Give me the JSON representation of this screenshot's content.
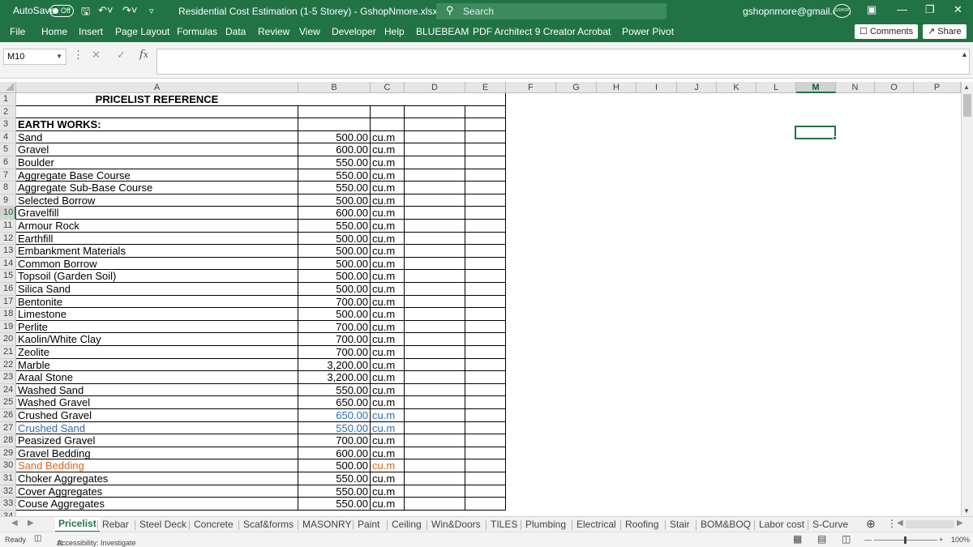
{
  "titlebar": {
    "autosave_label": "AutoSave",
    "autosave_state": "Off",
    "document_title": "Residential Cost Estimation (1-5 Storey) - GshopNmore.xlsx • Saved ∨",
    "search_placeholder": "Search",
    "account_email": "gshopnmore@gmail.com",
    "avatar_text": "GSHOP"
  },
  "ribbon": {
    "tabs": [
      "File",
      "Home",
      "Insert",
      "Page Layout",
      "Formulas",
      "Data",
      "Review",
      "View",
      "Developer",
      "Help",
      "BLUEBEAM",
      "PDF Architect 9 Creator",
      "Acrobat",
      "Power Pivot"
    ],
    "comments_label": "Comments",
    "share_label": "Share"
  },
  "formula_bar": {
    "name_box": "M10",
    "formula_value": ""
  },
  "columns": [
    "A",
    "B",
    "C",
    "D",
    "E",
    "F",
    "G",
    "H",
    "I",
    "J",
    "K",
    "L",
    "M",
    "N",
    "O",
    "P"
  ],
  "selected_column": "M",
  "selected_row": "10",
  "sheet": {
    "title": "PRICELIST REFERENCE",
    "section_header": "EARTH WORKS:",
    "rows": [
      {
        "n": "4",
        "item": "Sand",
        "price": "500.00",
        "unit": "cu.m"
      },
      {
        "n": "5",
        "item": "Gravel",
        "price": "600.00",
        "unit": "cu.m"
      },
      {
        "n": "6",
        "item": "Boulder",
        "price": "550.00",
        "unit": "cu.m"
      },
      {
        "n": "7",
        "item": "Aggregate Base Course",
        "price": "550.00",
        "unit": "cu.m"
      },
      {
        "n": "8",
        "item": "Aggregate Sub-Base Course",
        "price": "550.00",
        "unit": "cu.m"
      },
      {
        "n": "9",
        "item": "Selected Borrow",
        "price": "500.00",
        "unit": "cu.m"
      },
      {
        "n": "10",
        "item": "Gravelfill",
        "price": "600.00",
        "unit": "cu.m"
      },
      {
        "n": "11",
        "item": "Armour Rock",
        "price": "550.00",
        "unit": "cu.m"
      },
      {
        "n": "12",
        "item": "Earthfill",
        "price": "500.00",
        "unit": "cu.m"
      },
      {
        "n": "13",
        "item": "Embankment Materials",
        "price": "500.00",
        "unit": "cu.m"
      },
      {
        "n": "14",
        "item": "Common Borrow",
        "price": "500.00",
        "unit": "cu.m"
      },
      {
        "n": "15",
        "item": "Topsoil (Garden Soil)",
        "price": "500.00",
        "unit": "cu.m"
      },
      {
        "n": "16",
        "item": "Silica Sand",
        "price": "500.00",
        "unit": "cu.m"
      },
      {
        "n": "17",
        "item": "Bentonite",
        "price": "700.00",
        "unit": "cu.m"
      },
      {
        "n": "18",
        "item": "Limestone",
        "price": "500.00",
        "unit": "cu.m"
      },
      {
        "n": "19",
        "item": "Perlite",
        "price": "700.00",
        "unit": "cu.m"
      },
      {
        "n": "20",
        "item": "Kaolin/White Clay",
        "price": "700.00",
        "unit": "cu.m"
      },
      {
        "n": "21",
        "item": "Zeolite",
        "price": "700.00",
        "unit": "cu.m"
      },
      {
        "n": "22",
        "item": "Marble",
        "price": "3,200.00",
        "unit": "cu.m"
      },
      {
        "n": "23",
        "item": "Araal Stone",
        "price": "3,200.00",
        "unit": "cu.m"
      },
      {
        "n": "24",
        "item": "Washed Sand",
        "price": "550.00",
        "unit": "cu.m"
      },
      {
        "n": "25",
        "item": "Washed Gravel",
        "price": "650.00",
        "unit": "cu.m"
      },
      {
        "n": "26",
        "item": "Crushed Gravel",
        "price": "650.00",
        "unit": "cu.m",
        "style": "price-unit-blue"
      },
      {
        "n": "27",
        "item": "Crushed Sand",
        "price": "550.00",
        "unit": "cu.m",
        "style": "all-blue"
      },
      {
        "n": "28",
        "item": "Peasized Gravel",
        "price": "700.00",
        "unit": "cu.m"
      },
      {
        "n": "29",
        "item": "Gravel Bedding",
        "price": "600.00",
        "unit": "cu.m"
      },
      {
        "n": "30",
        "item": "Sand Bedding",
        "price": "500.00",
        "unit": "cu.m",
        "style": "item-unit-orange"
      },
      {
        "n": "31",
        "item": "Choker Aggregates",
        "price": "550.00",
        "unit": "cu.m"
      },
      {
        "n": "32",
        "item": "Cover Aggregates",
        "price": "550.00",
        "unit": "cu.m"
      },
      {
        "n": "33",
        "item": "Couse Aggregates",
        "price": "550.00",
        "unit": "cu.m"
      }
    ]
  },
  "sheet_tabs": [
    "Pricelist",
    "Rebar",
    "Steel Deck",
    "Concrete",
    "Scaf&forms",
    "MASONRY",
    "Paint",
    "Ceiling",
    "Win&Doors",
    "TILES",
    "Plumbing",
    "Electrical",
    "Roofing",
    "Stair",
    "BOM&BOQ",
    "Labor cost",
    "S-Curve"
  ],
  "active_sheet": "Pricelist",
  "statusbar": {
    "ready": "Ready",
    "accessibility": "Accessibility: Investigate",
    "zoom": "100%"
  },
  "colors": {
    "excel_green": "#217346",
    "blue_text": "#2e6db4",
    "orange_text": "#d9651b"
  }
}
